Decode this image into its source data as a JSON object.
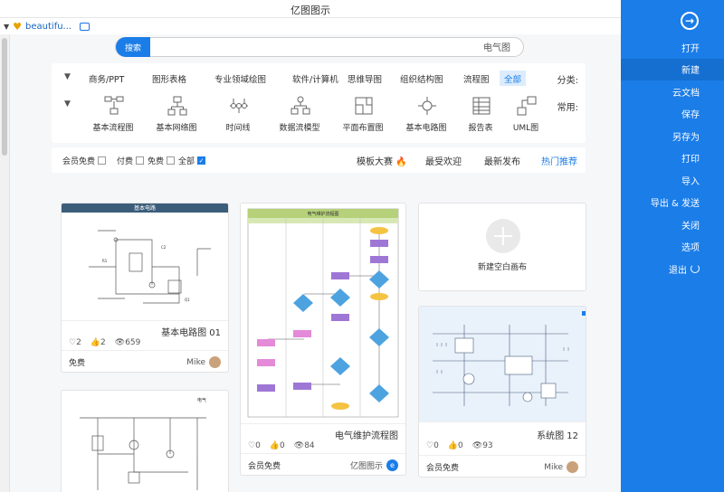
{
  "window": {
    "title": "亿图图示"
  },
  "tab": {
    "title": "beautifu..."
  },
  "sidebar": {
    "items": [
      {
        "label": "打开",
        "active": false
      },
      {
        "label": "新建",
        "active": true
      },
      {
        "label": "云文档",
        "active": false
      },
      {
        "label": "保存",
        "active": false
      },
      {
        "label": "另存为",
        "active": false
      },
      {
        "label": "打印",
        "active": false
      },
      {
        "label": "导入",
        "active": false
      },
      {
        "label": "导出 & 发送",
        "active": false
      },
      {
        "label": "关闭",
        "active": false
      },
      {
        "label": "选项",
        "active": false
      },
      {
        "label": "退出",
        "active": false
      }
    ]
  },
  "search": {
    "button": "搜索",
    "value": "电气图"
  },
  "categories": {
    "label": "分类:",
    "items": [
      "全部",
      "流程图",
      "组织结构图",
      "思维导图",
      "软件/计算机",
      "专业领域绘图",
      "图形表格",
      "商务/PPT"
    ]
  },
  "common": {
    "label": "常用:",
    "items": [
      "UML图",
      "报告表",
      "基本电路图",
      "平面布置图",
      "数据流模型",
      "时间线",
      "基本网络图",
      "基本流程图"
    ]
  },
  "filters": {
    "tabs": [
      "热门推荐",
      "最新发布",
      "最受欢迎",
      "模板大赛"
    ],
    "options": [
      "全部",
      "免费",
      "付费",
      "会员免费"
    ]
  },
  "cards": [
    {
      "name": "基本电路图 01",
      "thumb_title": "基本电路",
      "views": "659",
      "likes": "2",
      "hearts": "2",
      "author": "Mike",
      "badge": "免费"
    },
    {
      "name": "电气维护流程图",
      "thumb_title": "电气维护流程图",
      "views": "84",
      "likes": "0",
      "hearts": "0",
      "author": "亿图图示",
      "badge": "会员免费"
    },
    {
      "name": "新建空白画布"
    },
    {
      "name": "系统图 12",
      "views": "93",
      "likes": "0",
      "hearts": "0",
      "author": "Mike",
      "badge": "会员免费"
    }
  ],
  "colors": {
    "accent": "#1b7de8",
    "sidebar": "#1b7de8",
    "flame": "#ff6a00"
  }
}
